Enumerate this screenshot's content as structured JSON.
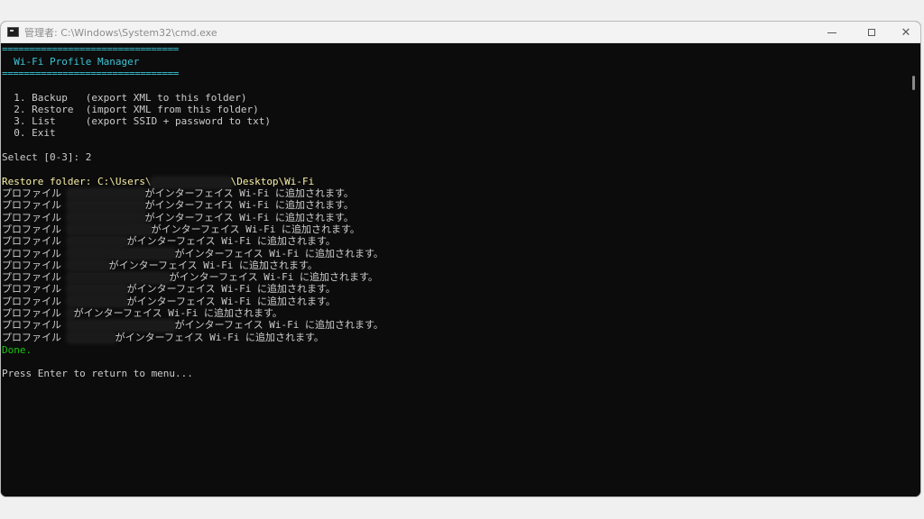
{
  "window": {
    "title": "管理者: C:\\Windows\\System32\\cmd.exe",
    "minimize_icon": "minimize-icon",
    "maximize_icon": "maximize-icon",
    "close_icon": "close-icon",
    "close_glyph": "✕"
  },
  "console": {
    "rule_top": "================================",
    "header_title": "  Wi-Fi Profile Manager",
    "rule_bottom": "================================",
    "menu": [
      "  1. Backup   (export XML to this folder)",
      "  2. Restore  (import XML from this folder)",
      "  3. List     (export SSID + password to txt)",
      "  0. Exit"
    ],
    "select_prompt": "Select [0-3]: 2",
    "restore_folder_prefix": "Restore folder: C:\\Users\\",
    "restore_folder_suffix": "\\Desktop\\Wi-Fi",
    "profile_prefix": "プロファイル ",
    "profile_suffix": "がインターフェイス Wi-Fi に追加されます。",
    "profile_rows": [
      {
        "redacted_chars": 13
      },
      {
        "redacted_chars": 13
      },
      {
        "redacted_chars": 13
      },
      {
        "redacted_chars": 14
      },
      {
        "redacted_chars": 10
      },
      {
        "redacted_chars": 18
      },
      {
        "redacted_chars": 7
      },
      {
        "redacted_chars": 17
      },
      {
        "redacted_chars": 10
      },
      {
        "redacted_chars": 10
      },
      {
        "redacted_chars": 1
      },
      {
        "redacted_chars": 18
      },
      {
        "redacted_chars": 8
      }
    ],
    "done": "Done.",
    "press_enter": "Press Enter to return to menu..."
  },
  "colors": {
    "background": "#0c0c0c",
    "header_cyan": "#3bc4d6",
    "restore_yellow": "#f9f1a5",
    "done_green": "#16c60c",
    "text_gray": "#cccccc"
  }
}
